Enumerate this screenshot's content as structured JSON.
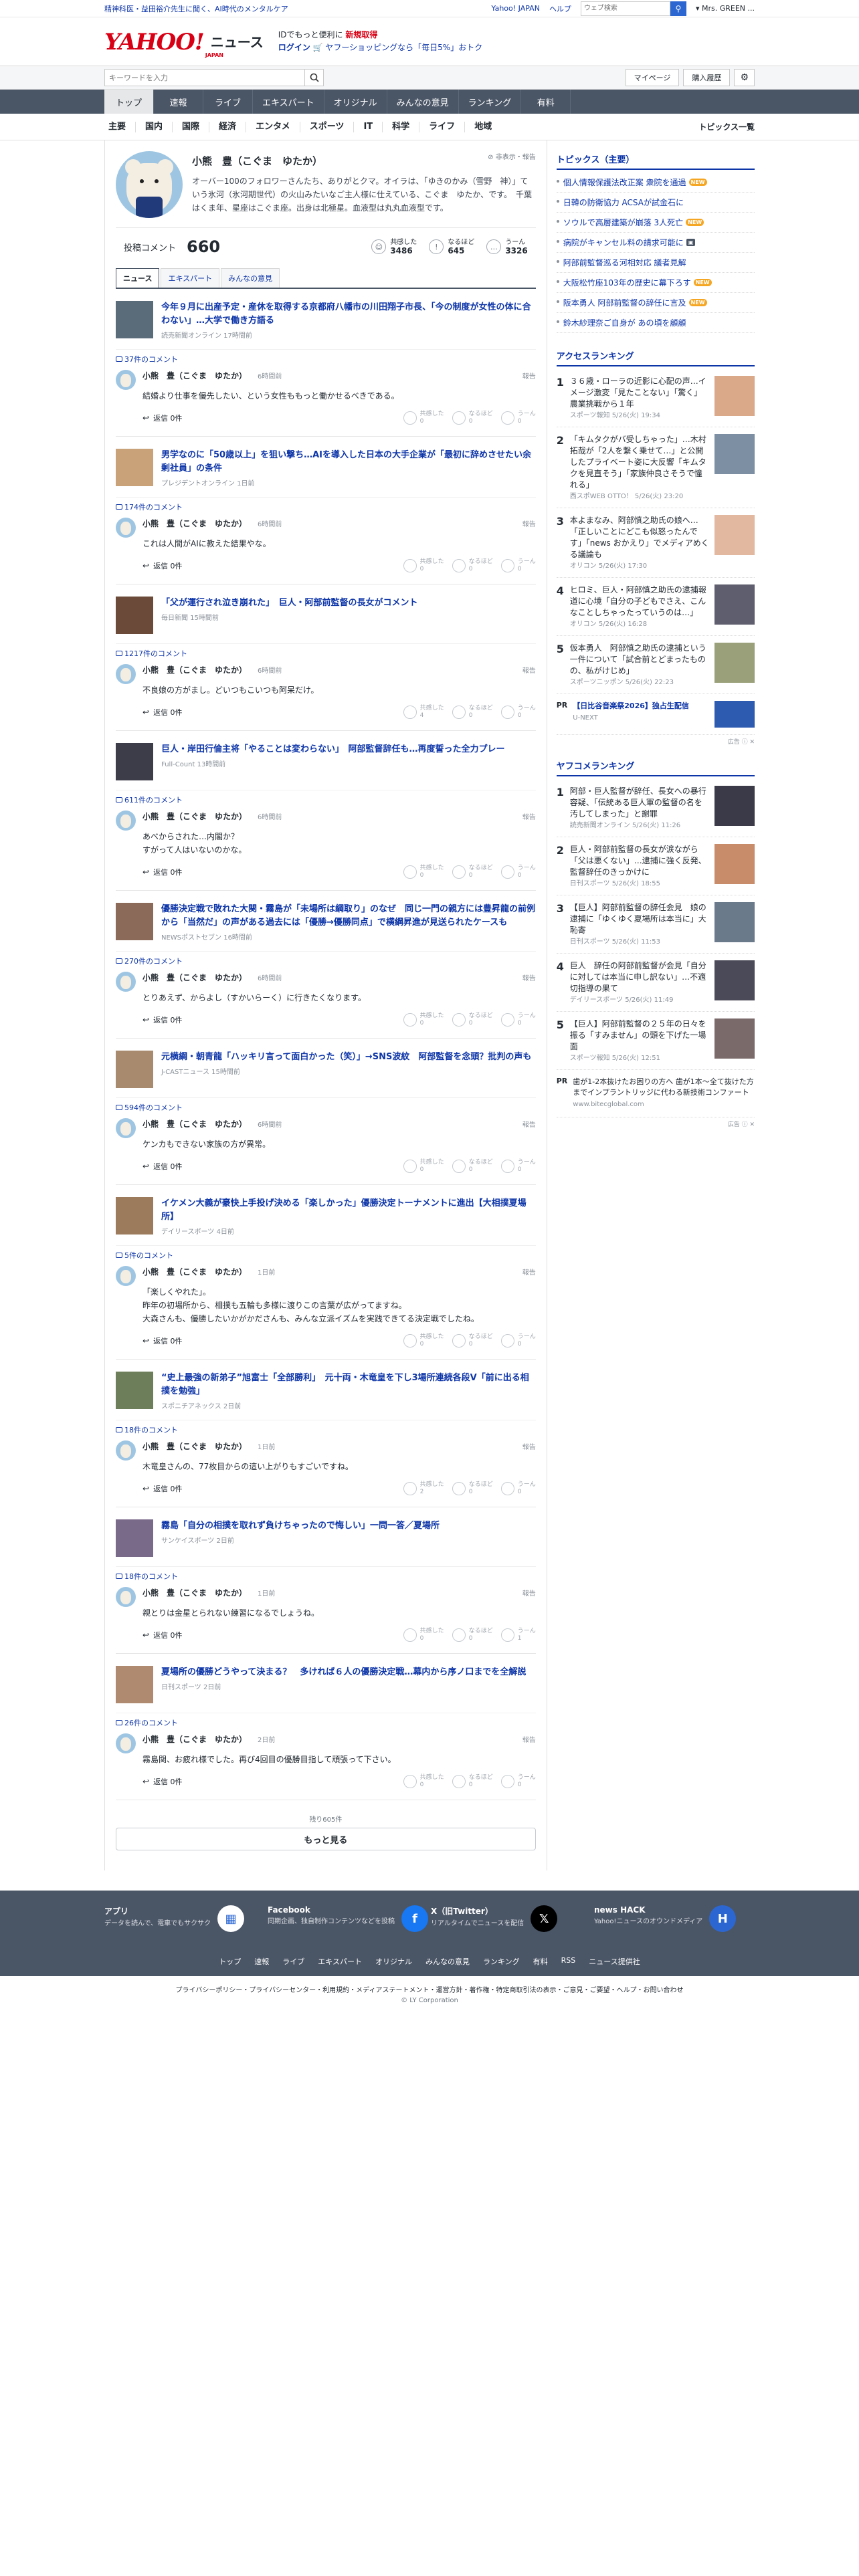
{
  "promo": {
    "left": "精神科医・益田裕介先生に聞く、AI時代のメンタルケア",
    "yj": "Yahoo! JAPAN",
    "help": "ヘルプ",
    "search_placeholder": "ウェブ検索",
    "user": "Mrs. GREEN ..."
  },
  "masthead": {
    "logo": "YAHOO!",
    "logo_jp": "JAPAN",
    "section": "ニュース",
    "login_line1_pre": "IDでもっと便利に",
    "login_line1_b": "新規取得",
    "login_line2_a": "ログイン",
    "login_line2_b": "ヤフーショッピングなら「毎日5%」おトク"
  },
  "searchrow": {
    "placeholder": "キーワードを入力",
    "mypage": "マイページ",
    "history": "購入履歴"
  },
  "mainnav": [
    "トップ",
    "速報",
    "ライブ",
    "エキスパート",
    "オリジナル",
    "みんなの意見",
    "ランキング",
    "有料"
  ],
  "subnav": {
    "cats": [
      "主要",
      "国内",
      "国際",
      "経済",
      "エンタメ",
      "スポーツ",
      "IT",
      "科学",
      "ライフ",
      "地域"
    ],
    "topics": "トピックス一覧"
  },
  "profile": {
    "name": "小熊　豊（こぐま　ゆたか）",
    "report": "非表示・報告",
    "bio": "オーバー100のフォロワーさんたち、ありがとクマ。オイラは、「ゆきのかみ（雪野　神）」ていう氷河（氷河期世代）の火山みたいなご主人様に仕えている、こぐま　ゆたか、です。　千葉はくま年、星座はこぐま座。出身は北極星。血液型は丸丸血液型です。",
    "post_label": "投稿コメント",
    "post_count": "660",
    "reactions": [
      {
        "label": "共感した",
        "value": "3486",
        "icon": "☺"
      },
      {
        "label": "なるほど",
        "value": "645",
        "icon": "!"
      },
      {
        "label": "うーん",
        "value": "3326",
        "icon": "…"
      }
    ]
  },
  "tabs": [
    "ニュース",
    "エキスパート",
    "みんなの意見"
  ],
  "comments": [
    {
      "title": "今年９月に出産予定・産休を取得する京都府八幡市の川田翔子市長、「今の制度が女性の体に合わない」…大学で働き方語る",
      "source": "読売新聞オンライン 17時間前",
      "count": "37件のコメント",
      "time": "6時間前",
      "text": "結婚より仕事を優先したい、という女性ももっと働かせるべきである。",
      "reply": "返信 0件",
      "r": [
        "0",
        "0",
        "0"
      ]
    },
    {
      "title": "男学なのに「50歳以上」を狙い撃ち…AIを導入した日本の大手企業が「最初に辞めさせたい余剰社員」の条件",
      "source": "プレジデントオンライン 1日前",
      "count": "174件のコメント",
      "time": "6時間前",
      "text": "これは人間がAIに教えた結果やな。",
      "reply": "返信 0件",
      "r": [
        "0",
        "0",
        "0"
      ]
    },
    {
      "title": "「父が運行され泣き崩れた」　巨人・阿部前監督の長女がコメント",
      "source": "毎日新聞 15時間前",
      "count": "1217件のコメント",
      "time": "6時間前",
      "text": "不良娘の方がまし。どいつもこいつも阿呆だけ。",
      "reply": "返信 0件",
      "r": [
        "4",
        "0",
        "0"
      ]
    },
    {
      "title": "巨人・岸田行倫主将「やることは変わらない」　阿部監督辞任も…再度誓った全力プレー",
      "source": "Full-Count 13時間前",
      "count": "611件のコメント",
      "time": "6時間前",
      "text": "あべからされた…内閣か？\nすがって人はいないのかな。",
      "reply": "返信 0件",
      "r": [
        "0",
        "0",
        "0"
      ]
    },
    {
      "title": "優勝決定戦で敗れた大関・霧島が「未場所は綱取り」のなぜ　同じ一門の親方には豊昇龍の前例から「当然だ」の声がある過去には「優勝→優勝同点」で横綱昇進が見送られたケースも",
      "source": "NEWSポストセブン 16時間前",
      "count": "270件のコメント",
      "time": "6時間前",
      "text": "とりあえず、からよし（すかいらーく）に行きたくなります。",
      "reply": "返信 0件",
      "r": [
        "0",
        "0",
        "0"
      ]
    },
    {
      "title": "元横綱・朝青龍「ハッキリ言って面白かった（笑）」→SNS波紋　阿部監督を念頭？批判の声も",
      "source": "J-CASTニュース 15時間前",
      "count": "594件のコメント",
      "time": "6時間前",
      "text": "ケンカもできない家族の方が異常。",
      "reply": "返信 0件",
      "r": [
        "0",
        "0",
        "0"
      ]
    },
    {
      "title": "イケメン大義が豪快上手投げ決める「楽しかった」優勝決定トーナメントに進出【大相撲夏場所】",
      "source": "デイリースポーツ 4日前",
      "count": "5件のコメント",
      "time": "1日前",
      "text": "「楽しくやれた」。\n昨年の初場所から、相撲も五輪も多様に渡りこの言葉が広がってますね。\n大森さんも、優勝したいかがかださんも、みんな立派イズムを実践できてる決定戦でしたね。",
      "reply": "返信 0件",
      "r": [
        "0",
        "0",
        "0"
      ]
    },
    {
      "title": "“史上最強の新弟子”旭富士「全部勝利」　元十両・木竜皇を下し3場所連続各段V「前に出る相撲を勉強」",
      "source": "スポニチアネックス 2日前",
      "count": "18件のコメント",
      "time": "1日前",
      "text": "木竜皇さんの、77枚目からの這い上がりもすごいですね。",
      "reply": "返信 0件",
      "r": [
        "2",
        "0",
        "0"
      ]
    },
    {
      "title": "霧島「自分の相撲を取れず負けちゃったので悔しい」一問一答／夏場所",
      "source": "サンケイスポーツ 2日前",
      "count": "18件のコメント",
      "time": "1日前",
      "text": "親とりは金星とられない練習になるでしょうね。",
      "reply": "返信 0件",
      "r": [
        "0",
        "0",
        "1"
      ]
    },
    {
      "title": "夏場所の優勝どうやって決まる？　多ければ６人の優勝決定戦…幕内から序ノ口までを全解説",
      "source": "日刊スポーツ 2日前",
      "count": "26件のコメント",
      "time": "2日前",
      "text": "霧島関、お疲れ様でした。再び4回目の優勝目指して頑張って下さい。",
      "reply": "返信 0件",
      "r": [
        "0",
        "0",
        "0"
      ]
    }
  ],
  "more": {
    "remaining": "残り605件",
    "button": "もっと見る"
  },
  "side": {
    "topics_title": "トピックス（主要）",
    "topics": [
      {
        "t": "個人情報保護法改正案 衆院を通過",
        "b": "new"
      },
      {
        "t": "日韓の防衛協力 ACSAが試金石に",
        "b": ""
      },
      {
        "t": "ソウルで高層建築が崩落 3人死亡",
        "b": "new"
      },
      {
        "t": "病院がキャンセル料の請求可能に",
        "b": "cam"
      },
      {
        "t": "阿部前監督巡る河相対応 議者見解",
        "b": ""
      },
      {
        "t": "大阪松竹座103年の歴史に幕下ろす",
        "b": "new"
      },
      {
        "t": "阪本勇人 阿部前監督の辞任に言及",
        "b": "new"
      },
      {
        "t": "鈴木紗理奈ご自身が あの頃を顧顧",
        "b": ""
      }
    ],
    "access_title": "アクセスランキング",
    "access": [
      {
        "t": "３６歳・ローラの近影に心配の声…イメージ激変「見たことない」「驚く」農業挑戦から１年",
        "s": "スポーツ報知 5/26(火) 19:34"
      },
      {
        "t": "「キムタクがバ受しちゃった」…木村拓哉が「2人を繋く乗せて…」と公開したプライベート姿に大反響「キムタクを見直そう」「家族仲良さそうで憧れる」",
        "s": "西スポWEB OTTO！ 5/26(火) 23:20"
      },
      {
        "t": "本よまなみ、阿部慎之助氏の娘へ…「正しいことにどこも似怒ったんです」「news おかえり」でメディアめくる議論も",
        "s": "オリコン 5/26(火) 17:30"
      },
      {
        "t": "ヒロミ、巨人・阿部慎之助氏の逮捕報道に心境「自分の子どもでさえ、こんなことしちゃったっていうのは…」",
        "s": "オリコン 5/26(火) 16:28"
      },
      {
        "t": "仮本勇人　阿部慎之助氏の逮捕という一件について「試合前とどまったものの、私がけじめ」",
        "s": "スポーツニッポン 5/26(火) 22:23"
      }
    ],
    "pr1": {
      "label": "PR",
      "text": "【日比谷音楽祭2026】独占生配信",
      "src": "U-NEXT"
    },
    "yafuko_title": "ヤフコメランキング",
    "yafuko": [
      {
        "t": "阿部・巨人監督が辞任、長女への暴行容疑、「伝統ある巨人軍の監督の名を汚してしまった」と謝罪",
        "s": "読売新聞オンライン 5/26(火) 11:26"
      },
      {
        "t": "巨人・阿部前監督の長女が涙ながら「父は悪くない」…逮捕に強く反発、監督辞任のきっかけに",
        "s": "日刊スポーツ 5/26(火) 18:55"
      },
      {
        "t": "【巨人】阿部前監督の辞任会見　娘の逮捕に「ゆくゆく夏場所は本当に」大恥寄",
        "s": "日刊スポーツ 5/26(火) 11:53"
      },
      {
        "t": "巨人　辞任の阿部前監督が会見「自分に対しては本当に申し訳ない」…不適切指導の果て",
        "s": "デイリースポーツ 5/26(火) 11:49"
      },
      {
        "t": "【巨人】阿部前監督の２５年の日々を振る「すみません」の頭を下げた一場面",
        "s": "スポーツ報知 5/26(火) 12:51"
      }
    ],
    "pr2": {
      "label": "PR",
      "text": "歯が1-2本抜けたお困りの方へ 歯が1本〜全て抜けた方までインプラントリッジに代わる新技術コンファート",
      "src": "www.bitecglobal.com"
    },
    "adinfo": "広告 ⓘ ✕"
  },
  "footer": {
    "apps": [
      {
        "t": "アプリ",
        "d": "データを読んで、電車でもサクサク",
        "icon": "▦",
        "bg": "#ffffff",
        "fg": "#2c67d1"
      },
      {
        "t": "Facebook",
        "d": "同期企画、独自制作コンテンツなどを投稿",
        "icon": "f",
        "bg": "#1877f2",
        "fg": "#ffffff"
      },
      {
        "t": "X（旧Twitter）",
        "d": "リアルタイムでニュースを配信",
        "icon": "𝕏",
        "bg": "#000000",
        "fg": "#ffffff"
      },
      {
        "t": "news HACK",
        "d": "Yahoo!ニュースのオウンドメディア",
        "icon": "H",
        "bg": "#2c67d1",
        "fg": "#ffffff"
      }
    ],
    "links": [
      "トップ",
      "速報",
      "ライブ",
      "エキスパート",
      "オリジナル",
      "みんなの意見",
      "ランキング",
      "有料",
      "RSS",
      "ニュース提供社"
    ],
    "legal": "プライバシーポリシー・プライバシーセンター・利用規約・メディアステートメント・運営方針・著作権・特定商取引法の表示・ご意見・ご要望・ヘルプ・お問い合わせ",
    "copy": "© LY Corporation"
  }
}
